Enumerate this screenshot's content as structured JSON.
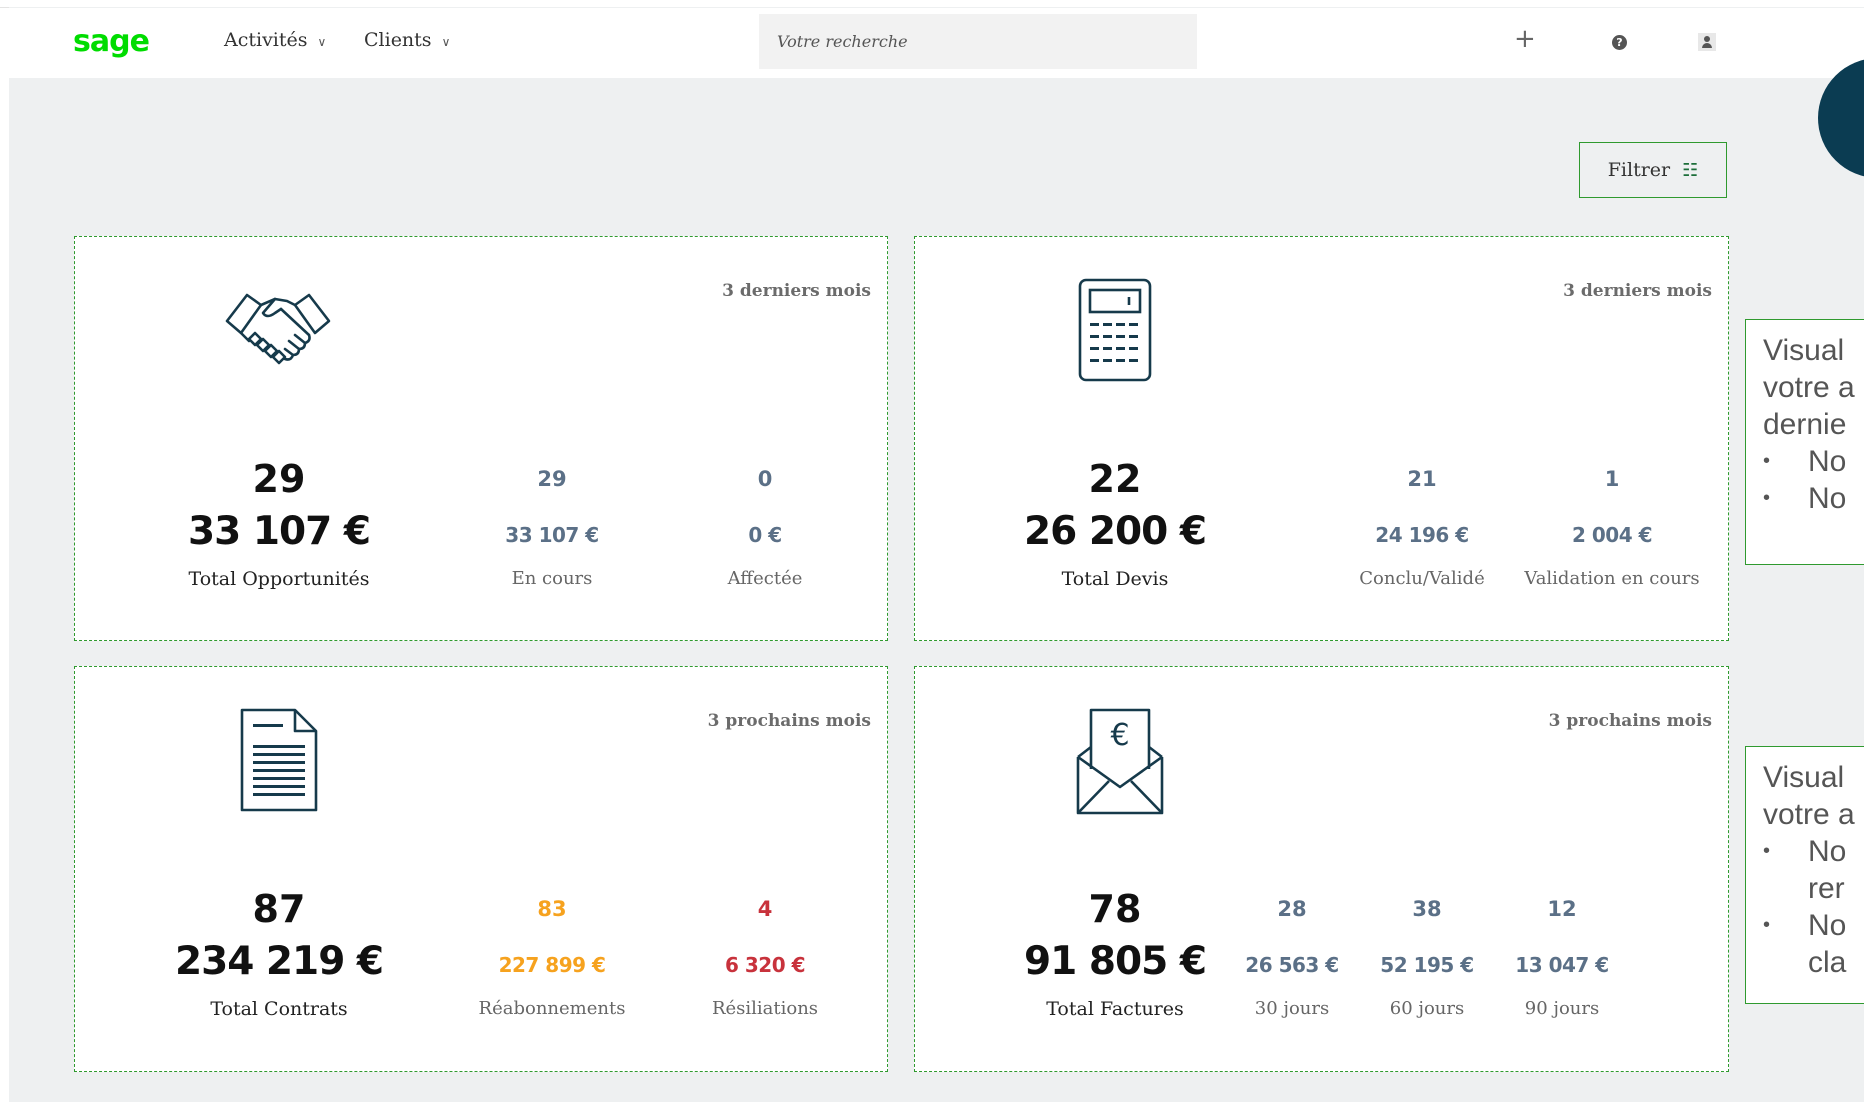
{
  "header": {
    "logo": "sage",
    "nav": [
      {
        "label": "Activités"
      },
      {
        "label": "Clients"
      }
    ],
    "search_placeholder": "Votre recherche",
    "icons": [
      "plus-icon",
      "help-icon",
      "user-icon"
    ]
  },
  "filter_label": "Filtrer",
  "colors": {
    "brand": "#00dc00",
    "border": "#2f9a2f",
    "accent_blue": "#5b7087",
    "orange": "#f6a21e",
    "red": "#c8323c",
    "bubble": "#0b3c52"
  },
  "cards": {
    "opportunites": {
      "icon": "handshake-icon",
      "period": "3 derniers mois",
      "count": "29",
      "amount": "33 107 €",
      "label": "Total Opportunités",
      "stats": [
        {
          "count": "29",
          "amount": "33 107 €",
          "label": "En cours"
        },
        {
          "count": "0",
          "amount": "0 €",
          "label": "Affectée"
        }
      ]
    },
    "devis": {
      "icon": "calculator-icon",
      "period": "3 derniers mois",
      "count": "22",
      "amount": "26 200 €",
      "label": "Total Devis",
      "stats": [
        {
          "count": "21",
          "amount": "24 196 €",
          "label": "Conclu/Validé"
        },
        {
          "count": "1",
          "amount": "2 004 €",
          "label": "Validation en cours"
        }
      ]
    },
    "contrats": {
      "icon": "document-icon",
      "period": "3 prochains mois",
      "count": "87",
      "amount": "234 219 €",
      "label": "Total Contrats",
      "stats": [
        {
          "count": "83",
          "amount": "227 899 €",
          "label": "Réabonnements"
        },
        {
          "count": "4",
          "amount": "6 320 €",
          "label": "Résiliations"
        }
      ]
    },
    "factures": {
      "icon": "invoice-envelope-icon",
      "period": "3 prochains mois",
      "count": "78",
      "amount": "91 805 €",
      "label": "Total Factures",
      "stats": [
        {
          "count": "28",
          "amount": "26 563 €",
          "label": "30 jours"
        },
        {
          "count": "38",
          "amount": "52 195 €",
          "label": "60 jours"
        },
        {
          "count": "12",
          "amount": "13 047 €",
          "label": "90 jours"
        }
      ]
    }
  },
  "notes": {
    "top": [
      "Visual",
      "votre a",
      "dernie",
      "No",
      "No"
    ],
    "bottom": [
      "Visual",
      "votre a",
      "No",
      "rer",
      "No",
      "cla"
    ]
  }
}
